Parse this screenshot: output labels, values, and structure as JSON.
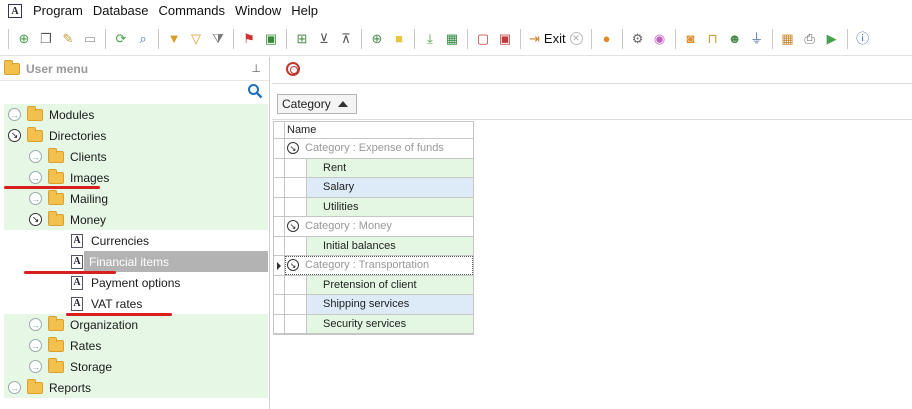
{
  "menubar": {
    "app_icon": "A",
    "items": [
      "Program",
      "Database",
      "Commands",
      "Window",
      "Help"
    ]
  },
  "toolbar": {
    "exit_label": "Exit",
    "icons": [
      "new-icon",
      "copy-icon",
      "edit-icon",
      "delete-icon",
      "refresh-icon",
      "search-icon",
      "filter-icon",
      "filter-clear-icon",
      "filter-settings-icon",
      "flag-icon",
      "image-icon",
      "split-icon",
      "expand-all-icon",
      "collapse-all-icon",
      "add-column-icon",
      "note-icon",
      "download-icon",
      "export-excel-icon",
      "close-window-icon",
      "close-all-icon",
      "exit-icon",
      "location-icon",
      "settings-icon",
      "color-wheel-icon",
      "rss-icon",
      "lock-icon",
      "users-icon",
      "plug-icon",
      "table-icon",
      "print-icon",
      "play-icon",
      "info-icon"
    ]
  },
  "left_panel": {
    "title": "User menu",
    "tree": [
      {
        "label": "Modules",
        "type": "folder",
        "level": 0,
        "expanded": false
      },
      {
        "label": "Directories",
        "type": "folder",
        "level": 0,
        "expanded": true
      },
      {
        "label": "Clients",
        "type": "folder",
        "level": 1,
        "expanded": false
      },
      {
        "label": "Images",
        "type": "folder",
        "level": 1,
        "expanded": false
      },
      {
        "label": "Mailing",
        "type": "folder",
        "level": 1,
        "expanded": false
      },
      {
        "label": "Money",
        "type": "folder",
        "level": 1,
        "expanded": true
      },
      {
        "label": "Currencies",
        "type": "item",
        "level": 2
      },
      {
        "label": "Financial items",
        "type": "item",
        "level": 2,
        "selected": true
      },
      {
        "label": "Payment options",
        "type": "item",
        "level": 2
      },
      {
        "label": "VAT rates",
        "type": "item",
        "level": 2
      },
      {
        "label": "Organization",
        "type": "folder",
        "level": 1,
        "expanded": false
      },
      {
        "label": "Rates",
        "type": "folder",
        "level": 1,
        "expanded": false
      },
      {
        "label": "Storage",
        "type": "folder",
        "level": 1,
        "expanded": false
      },
      {
        "label": "Reports",
        "type": "folder",
        "level": 0,
        "expanded": false
      }
    ]
  },
  "grid": {
    "group_chip": "Category",
    "column_header": "Name",
    "groups": [
      {
        "label": "Category : Expense of funds",
        "rows": [
          "Rent",
          "Salary",
          "Utilities"
        ]
      },
      {
        "label": "Category : Money",
        "rows": [
          "Initial balances"
        ]
      },
      {
        "label": "Category : Transportation",
        "rows": [
          "Pretension of client",
          "Shipping services",
          "Security services"
        ]
      }
    ]
  },
  "colors": {
    "tree_row_bg": "#e6f7e6",
    "selected_bg": "#b3b3b3",
    "annotation_red": "#d81e1e",
    "grid_green": "#e3f7e3",
    "grid_blue": "#dcebf7"
  }
}
